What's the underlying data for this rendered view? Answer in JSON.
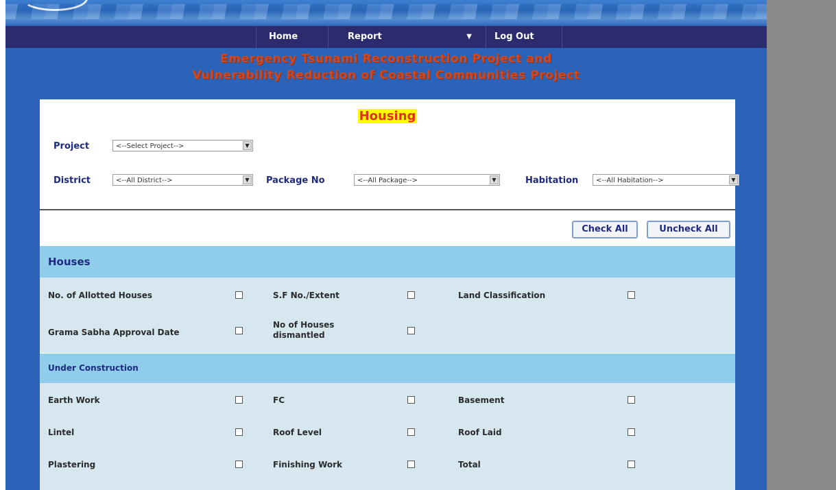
{
  "nav": {
    "home": "Home",
    "report": "Report",
    "report_caret": "▼",
    "logout": "Log Out"
  },
  "header": {
    "title_line1": "Emergency Tsunami Reconstruction Project and",
    "title_line2": "Vulnerability Reduction of Coastal Communities Project"
  },
  "page": {
    "title": "Housing"
  },
  "filters": {
    "project_label": "Project",
    "project_value": "<--Select Project-->",
    "district_label": "District",
    "district_value": "<--All District-->",
    "package_label": "Package No",
    "package_value": "<--All Package-->",
    "habitation_label": "Habitation",
    "habitation_value": "<--All Habitation-->"
  },
  "actions": {
    "check_all": "Check All",
    "uncheck_all": "Uncheck All"
  },
  "sections": {
    "houses": {
      "title": "Houses",
      "items": [
        "No. of Allotted Houses",
        "S.F No./Extent",
        "Land Classification",
        "Grama Sabha Approval Date",
        "No of Houses dismantled"
      ]
    },
    "under_construction": {
      "title": "Under Construction",
      "items": [
        "Earth Work",
        "FC",
        "Basement",
        "Lintel",
        "Roof Level",
        "Roof Laid",
        "Plastering",
        "Finishing Work",
        "Total"
      ]
    }
  },
  "colors": {
    "site_blue": "#2a63b8",
    "nav_bg": "#2b2b6e",
    "title_red": "#d2481c",
    "section_head": "#8fcdea",
    "section_body": "#d6e7f0",
    "label_blue": "#1d2a80",
    "housing_highlight": "#ffff00"
  },
  "icons": {
    "dropdown_arrow": "chevron-down-icon"
  }
}
